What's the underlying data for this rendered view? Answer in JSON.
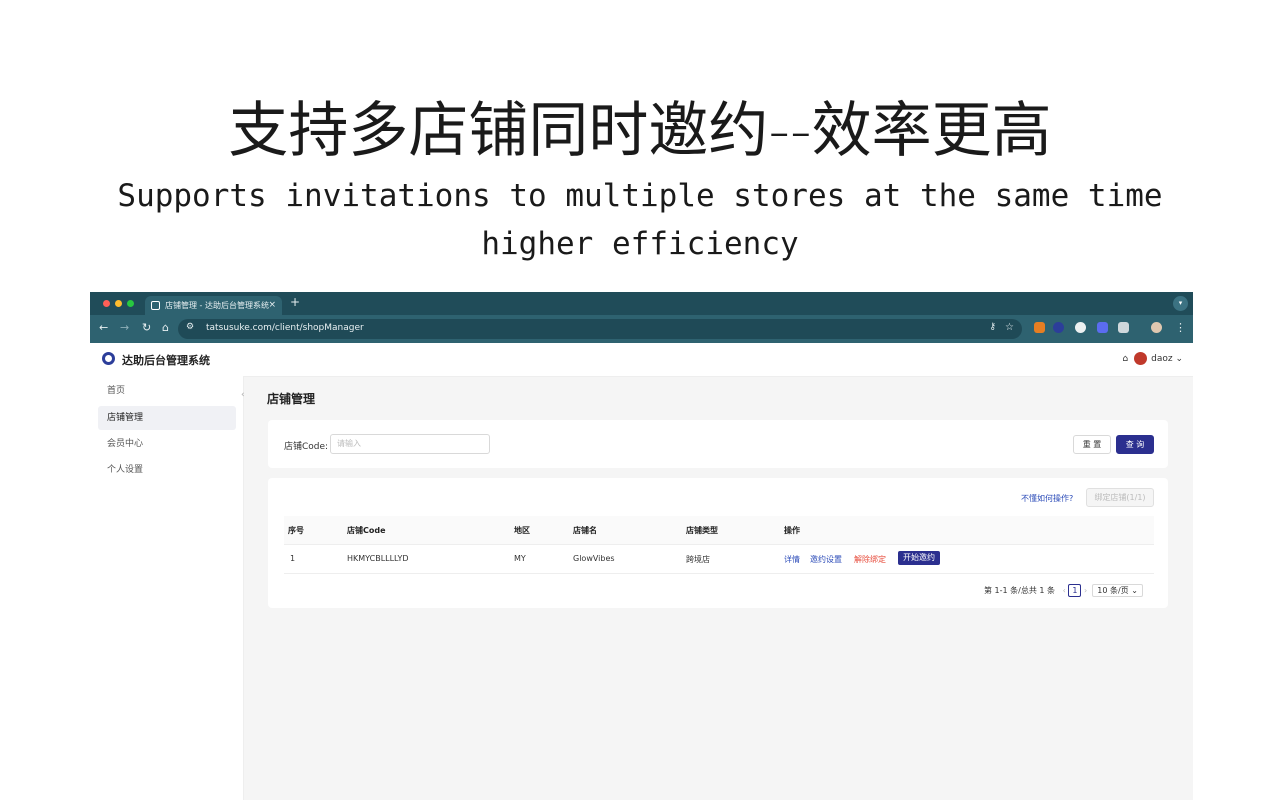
{
  "promo": {
    "headline": "支持多店铺同时邀约--效率更高",
    "subline_1": "Supports invitations to multiple stores at the same time",
    "subline_2": "higher efficiency"
  },
  "browser": {
    "tab_title": "店铺管理 - 达助后台管理系统",
    "tab_close": "×",
    "new_tab": "+",
    "url": "tatsusuke.com/client/shopManager"
  },
  "app": {
    "title": "达助后台管理系统",
    "username": "daoz",
    "sidebar": [
      "首页",
      "店铺管理",
      "会员中心",
      "个人设置"
    ],
    "page_title": "店铺管理",
    "search": {
      "label": "店铺Code:",
      "placeholder": "请输入",
      "reset": "重 置",
      "query": "查 询"
    },
    "help_link": "不懂如何操作?",
    "bind_button": "绑定店铺(1/1)",
    "table": {
      "headers": [
        "序号",
        "店铺Code",
        "地区",
        "店铺名",
        "店铺类型",
        "操作"
      ],
      "rows": [
        {
          "index": "1",
          "code": "HKMYCBLLLLYD",
          "region": "MY",
          "name": "GlowVibes",
          "type": "跨境店",
          "actions": {
            "detail": "详情",
            "settings": "邀约设置",
            "unbind": "解除绑定",
            "start": "开始邀约"
          }
        }
      ]
    },
    "pagination": {
      "summary": "第 1-1 条/总共 1 条",
      "current": "1",
      "page_size": "10 条/页"
    }
  },
  "colors": {
    "primary": "#2b2f8f",
    "danger": "#e74c3c",
    "browser_chrome": "#2e6270"
  }
}
